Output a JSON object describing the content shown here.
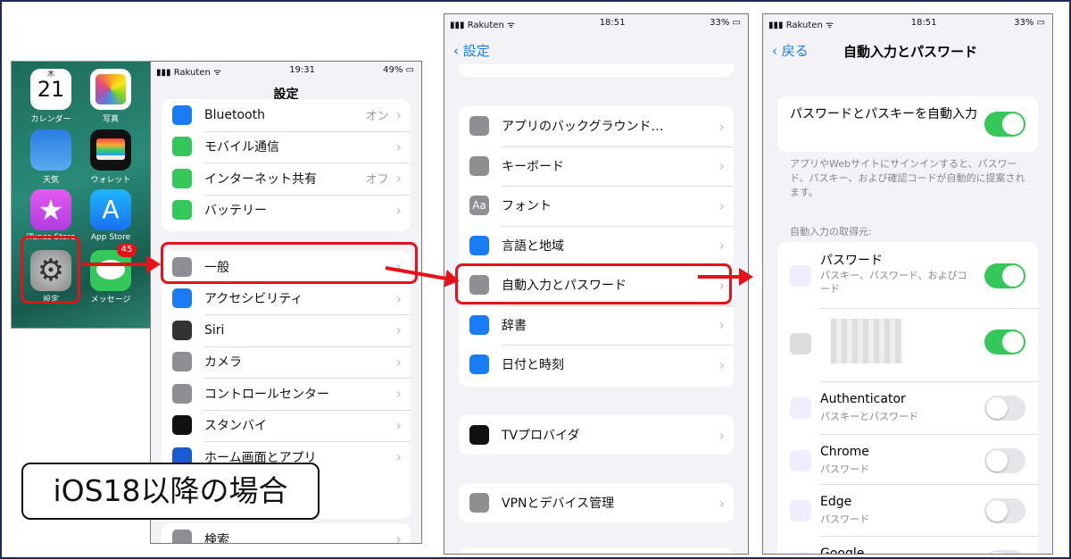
{
  "home": {
    "apps": [
      {
        "label": "カレンダー",
        "icon": "calendar-icon",
        "day": "21",
        "weekday": "木"
      },
      {
        "label": "写真",
        "icon": "photos-icon"
      },
      {
        "label": "天気",
        "icon": "weather-icon"
      },
      {
        "label": "ウォレット",
        "icon": "wallet-icon"
      },
      {
        "label": "iTunes Store",
        "icon": "itunes-star-icon"
      },
      {
        "label": "App Store",
        "icon": "app-store-icon"
      },
      {
        "label": "設定",
        "icon": "settings-gear-icon"
      },
      {
        "label": "メッセージ",
        "icon": "messages-icon",
        "badge": "45"
      }
    ]
  },
  "panel1": {
    "carrier": "Rakuten",
    "time": "19:31",
    "battery": "49%",
    "title": "設定",
    "group1": [
      {
        "label": "Bluetooth",
        "value": "オン",
        "color": "#1a7cf5",
        "icon": "bluetooth-icon"
      },
      {
        "label": "モバイル通信",
        "value": "",
        "color": "#34c759",
        "icon": "antenna-icon"
      },
      {
        "label": "インターネット共有",
        "value": "オフ",
        "color": "#34c759",
        "icon": "link-icon"
      },
      {
        "label": "バッテリー",
        "value": "",
        "color": "#34c759",
        "icon": "battery-icon"
      }
    ],
    "group2": [
      {
        "label": "一般",
        "color": "#8e8e93",
        "icon": "gear-icon"
      },
      {
        "label": "アクセシビリティ",
        "color": "#1a7cf5",
        "icon": "accessibility-icon"
      },
      {
        "label": "Siri",
        "color": "#333",
        "icon": "siri-icon"
      },
      {
        "label": "カメラ",
        "color": "#8e8e93",
        "icon": "camera-icon"
      },
      {
        "label": "コントロールセンター",
        "color": "#8e8e93",
        "icon": "toggles-icon"
      },
      {
        "label": "スタンバイ",
        "color": "#111",
        "icon": "standby-icon"
      },
      {
        "label": "ホーム画面とアプリ",
        "color": "#1a5cd5",
        "icon": "home-screen-icon"
      }
    ],
    "last": {
      "label": "検索",
      "color": "#8e8e93",
      "icon": "search-icon"
    }
  },
  "caption": "iOS18以降の場合",
  "panel2": {
    "carrier": "Rakuten",
    "time": "18:51",
    "battery": "33%",
    "back": "設定",
    "group1": [
      {
        "label": "アプリのバックグラウンド…",
        "color": "#8e8e93",
        "icon": "background-refresh-icon"
      },
      {
        "label": "キーボード",
        "color": "#8e8e93",
        "icon": "keyboard-icon"
      },
      {
        "label": "フォント",
        "color": "#8e8e93",
        "icon": "font-icon",
        "glyph": "Aa"
      },
      {
        "label": "言語と地域",
        "color": "#1a7cf5",
        "icon": "globe-icon"
      },
      {
        "label": "自動入力とパスワード",
        "color": "#8e8e93",
        "icon": "key-icon"
      },
      {
        "label": "辞書",
        "color": "#1a7cf5",
        "icon": "dictionary-icon"
      },
      {
        "label": "日付と時刻",
        "color": "#1a7cf5",
        "icon": "calendar-clock-icon"
      }
    ],
    "group2": [
      {
        "label": "TVプロバイダ",
        "color": "#111",
        "icon": "tv-provider-icon"
      }
    ],
    "group3": [
      {
        "label": "VPNとデバイス管理",
        "color": "#8e8e93",
        "icon": "gear-icon"
      }
    ]
  },
  "panel3": {
    "carrier": "Rakuten",
    "time": "18:51",
    "battery": "33%",
    "back": "戻る",
    "title": "自動入力とパスワード",
    "autofill": {
      "label": "パスワードとパスキーを自動入力",
      "on": true
    },
    "description": "アプリやWebサイトにサインインすると、パスワード、パスキー、および確認コードが自動的に提案されます。",
    "section": "自動入力の取得元:",
    "sources": [
      {
        "label": "パスワード",
        "sub": "パスキー、パスワード、およびコード",
        "on": true,
        "icon": "passwords-app-icon"
      },
      {
        "label": "",
        "sub": "",
        "on": true,
        "icon": "blurred-app-icon"
      },
      {
        "label": "Authenticator",
        "sub": "パスキーとパスワード",
        "on": false,
        "icon": "authenticator-icon"
      },
      {
        "label": "Chrome",
        "sub": "パスワード",
        "on": false,
        "icon": "chrome-icon"
      },
      {
        "label": "Edge",
        "sub": "パスワード",
        "on": false,
        "icon": "edge-icon"
      },
      {
        "label": "Google",
        "sub": "",
        "on": false,
        "icon": "google-icon"
      }
    ]
  },
  "colors": {
    "highlight": "#e5121a",
    "toggle_on": "#34c759"
  }
}
